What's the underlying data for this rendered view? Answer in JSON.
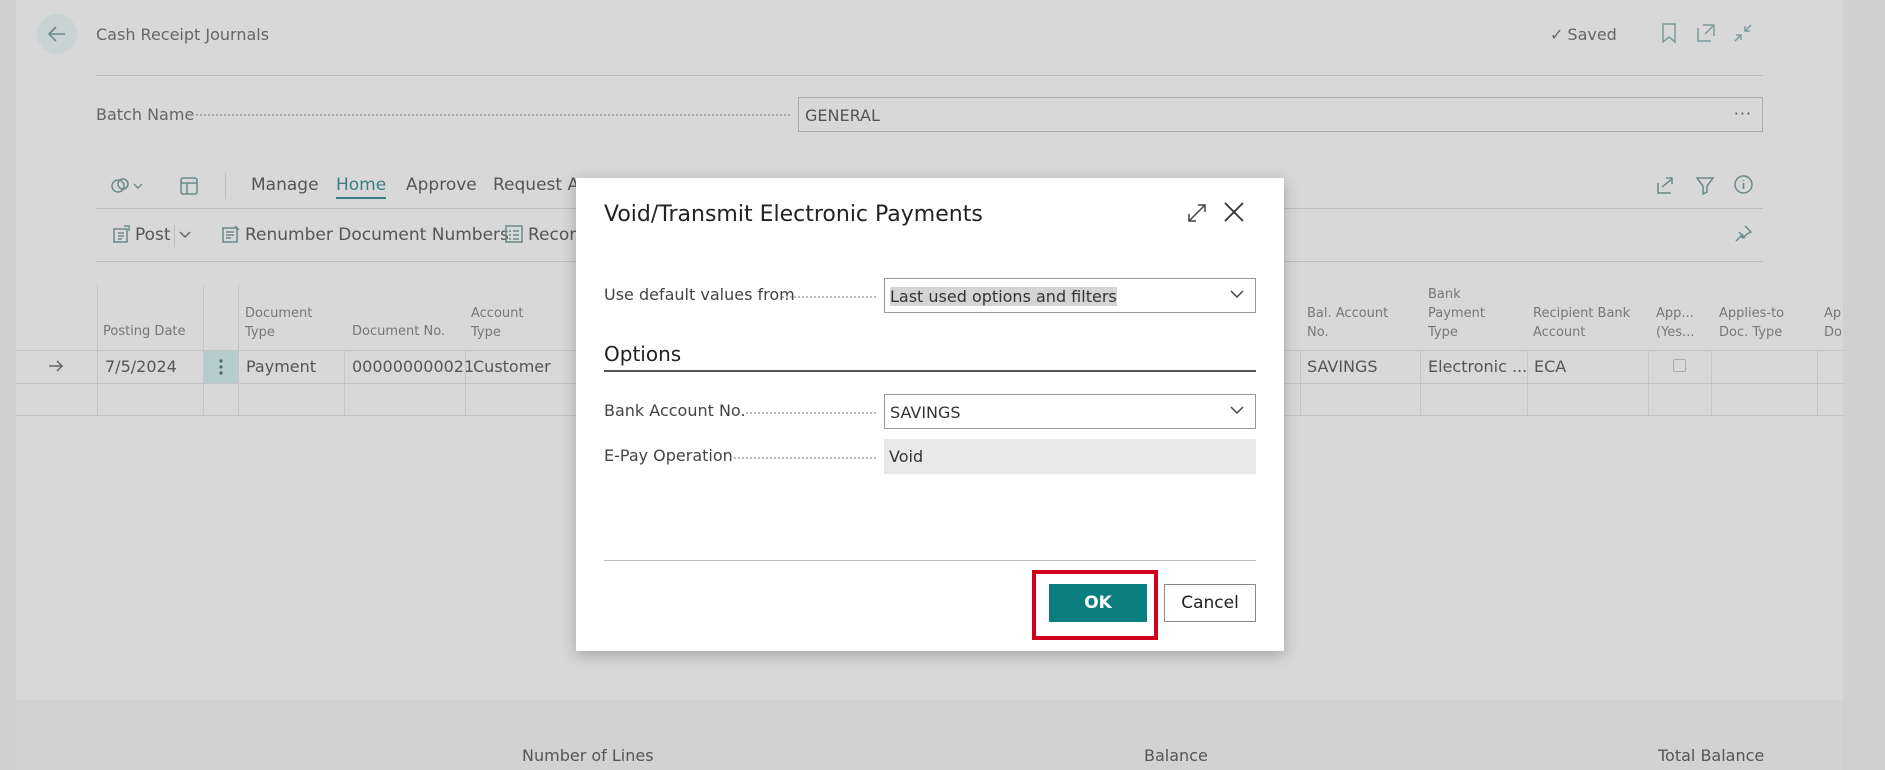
{
  "header": {
    "page_title": "Cash Receipt Journals",
    "saved": "Saved"
  },
  "batch": {
    "label": "Batch Name",
    "value": "GENERAL",
    "more": "···"
  },
  "menu": {
    "items": [
      "Manage",
      "Home",
      "Approve",
      "Request Ap"
    ]
  },
  "actions": {
    "post": "Post",
    "renumber": "Renumber Document Numbers",
    "reconcile": "Reconc"
  },
  "grid": {
    "headers": {
      "posting_date": "Posting Date",
      "document_type": [
        "Document",
        "Type"
      ],
      "document_no": "Document No.",
      "account_type": [
        "Account",
        "Type"
      ],
      "bal_account_no": [
        "Bal. Account",
        "No."
      ],
      "bank_payment_type": [
        "Bank",
        "Payment",
        "Type"
      ],
      "recipient_bank": [
        "Recipient Bank",
        "Account"
      ],
      "applies_yes": [
        "App...",
        "(Yes..."
      ],
      "applies_doc_type": [
        "Applies-to",
        "Doc. Type"
      ],
      "applies_more": [
        "Ap",
        "Do"
      ]
    },
    "row": {
      "posting_date": "7/5/2024",
      "document_type": "Payment",
      "document_no": "000000000021",
      "account_type": "Customer",
      "bal_account_no": "SAVINGS",
      "bank_payment_type": "Electronic ...",
      "recipient_bank": "ECA"
    }
  },
  "footer": {
    "number_of_lines": "Number of Lines",
    "balance": "Balance",
    "total_balance": "Total Balance"
  },
  "dialog": {
    "title": "Void/Transmit Electronic Payments",
    "use_default_label": "Use default values from",
    "use_default_value": "Last used options and filters",
    "options_heading": "Options",
    "bank_account_label": "Bank Account No.",
    "bank_account_value": "SAVINGS",
    "epay_label": "E-Pay Operation",
    "epay_value": "Void",
    "ok": "OK",
    "cancel": "Cancel",
    "ok_highlight_color": "#d0021b",
    "accent_color": "#0b7f80"
  }
}
